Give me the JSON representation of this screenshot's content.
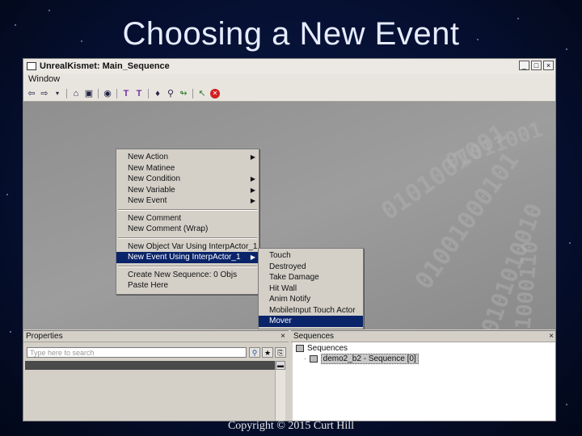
{
  "slide": {
    "title": "Choosing a New Event",
    "copyright": "Copyright © 2015 Curt Hill"
  },
  "window": {
    "title": "UnrealKismet: Main_Sequence",
    "controls": [
      "_",
      "□",
      "×"
    ]
  },
  "menubar": {
    "items": [
      "Window"
    ]
  },
  "toolbar": {
    "icons": [
      "back-arrow-icon",
      "forward-arrow-icon",
      "dropdown-icon",
      "home-icon",
      "parent-sequence-icon",
      "search-icon",
      "align-icon",
      "align-alt-icon",
      "light-icon",
      "zoom-icon",
      "link-icon",
      "goto-icon",
      "stop-icon"
    ]
  },
  "context_menu": {
    "items": [
      {
        "label": "New Action",
        "submenu": true
      },
      {
        "label": "New Matinee",
        "submenu": false
      },
      {
        "label": "New Condition",
        "submenu": true
      },
      {
        "label": "New Variable",
        "submenu": true
      },
      {
        "label": "New Event",
        "submenu": true
      },
      {
        "label": "New Comment",
        "submenu": false
      },
      {
        "label": "New Comment (Wrap)",
        "submenu": false
      },
      {
        "label": "New Object Var Using InterpActor_1",
        "submenu": false
      },
      {
        "label": "New Event Using InterpActor_1",
        "submenu": true,
        "highlighted": true
      },
      {
        "label": "Create New Sequence: 0 Objs",
        "submenu": false
      },
      {
        "label": "Paste Here",
        "submenu": false
      }
    ]
  },
  "submenu": {
    "items": [
      "Touch",
      "Destroyed",
      "Take Damage",
      "Hit Wall",
      "Anim Notify",
      "MobileInput Touch Actor",
      "Mover"
    ],
    "highlighted": "Mover"
  },
  "properties_panel": {
    "title": "Properties",
    "search_placeholder": "Type here to search",
    "close": "×"
  },
  "sequences_panel": {
    "title": "Sequences",
    "close": "×",
    "root": "Sequences",
    "child": "demo2_b2 - Sequence [0]"
  },
  "canvas_decoration": [
    "0101001001",
    "01001000101",
    "0101010010",
    "01000110",
    "01011001"
  ],
  "colors": {
    "highlight": "#0a246a",
    "menu_bg": "#d4d0c8",
    "canvas": "#959595"
  }
}
